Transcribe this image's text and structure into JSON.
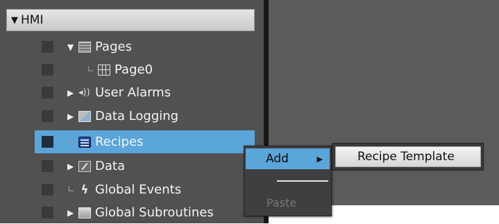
{
  "tree": {
    "root_label": "HMI",
    "items": [
      {
        "label": "Pages",
        "expander": "▼"
      },
      {
        "label": "Page0",
        "expander": "∟"
      },
      {
        "label": "User Alarms",
        "expander": "▶"
      },
      {
        "label": "Data Logging",
        "expander": "▶"
      },
      {
        "label": "Recipes",
        "expander": "∟",
        "selected": true
      },
      {
        "label": "Data",
        "expander": "▶"
      },
      {
        "label": "Global Events",
        "expander": "∟"
      },
      {
        "label": "Global Subroutines",
        "expander": "▶"
      }
    ]
  },
  "context_menu": {
    "add_label": "Add",
    "add_arrow": "▶",
    "paste_label": "Paste"
  },
  "submenu": {
    "item_label": "Recipe Template"
  },
  "icons": {
    "pages": "pages-icon",
    "page0": "page-grid-icon",
    "user_alarms": "speaker-icon",
    "data_logging": "data-logging-icon",
    "recipes": "recipes-icon",
    "data": "data-icon",
    "global_events": "lightning-icon",
    "global_subroutines": "subroutines-icon"
  },
  "colors": {
    "selection": "#5aa5d9",
    "panel": "#515151"
  }
}
